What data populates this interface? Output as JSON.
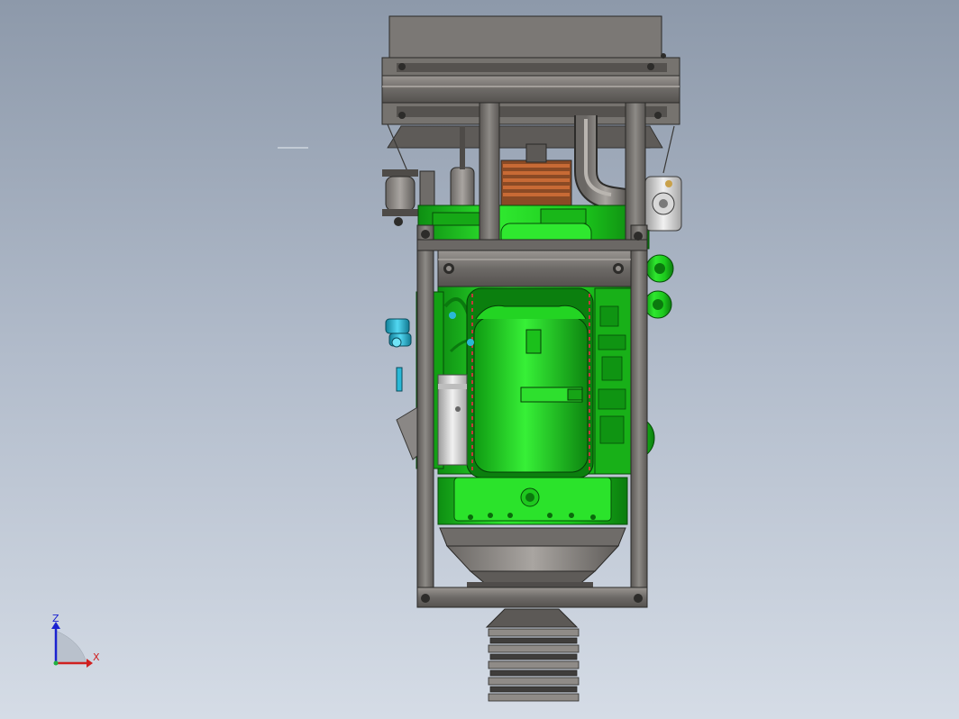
{
  "viewport": {
    "background_top": "#8d99aa",
    "background_bottom": "#d5dce6"
  },
  "model": {
    "engine_color": "#1fd41f",
    "engine_dark": "#0f8f12",
    "frame_color": "#7e7b78",
    "frame_dark": "#4f4c4a",
    "accent_cyan": "#2ab8d6",
    "belt_copper": "#c86a35"
  },
  "triad": {
    "z_label": "Z",
    "x_label": "X",
    "z_color": "#1a22d0",
    "x_color": "#d02020",
    "y_color": "#20b040"
  }
}
